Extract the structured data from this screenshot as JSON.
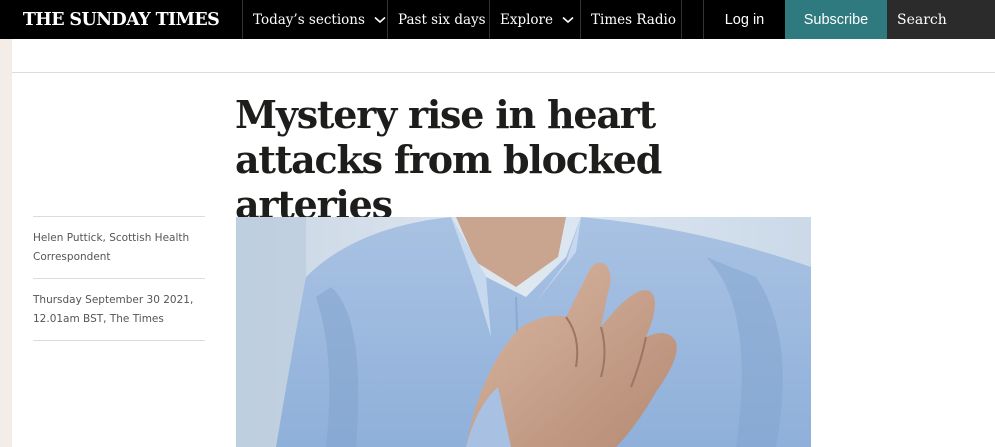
{
  "nav": {
    "masthead": "THE SUNDAY TIMES",
    "items": [
      {
        "label": "Today’s sections",
        "has_dropdown": true
      },
      {
        "label": "Past six days",
        "has_dropdown": false
      },
      {
        "label": "Explore",
        "has_dropdown": true
      },
      {
        "label": "Times Radio",
        "has_dropdown": false
      }
    ],
    "login": "Log in",
    "subscribe": "Subscribe",
    "search": "Search",
    "subscribe_color": "#2e7a7f"
  },
  "article": {
    "headline": "Mystery rise in heart attacks from blocked arteries",
    "author": "Helen Puttick, Scottish Health Correspondent",
    "dateline": "Thursday September 30 2021, 12.01am BST, The Times",
    "hero_image": "person-clutching-chest-photo"
  }
}
